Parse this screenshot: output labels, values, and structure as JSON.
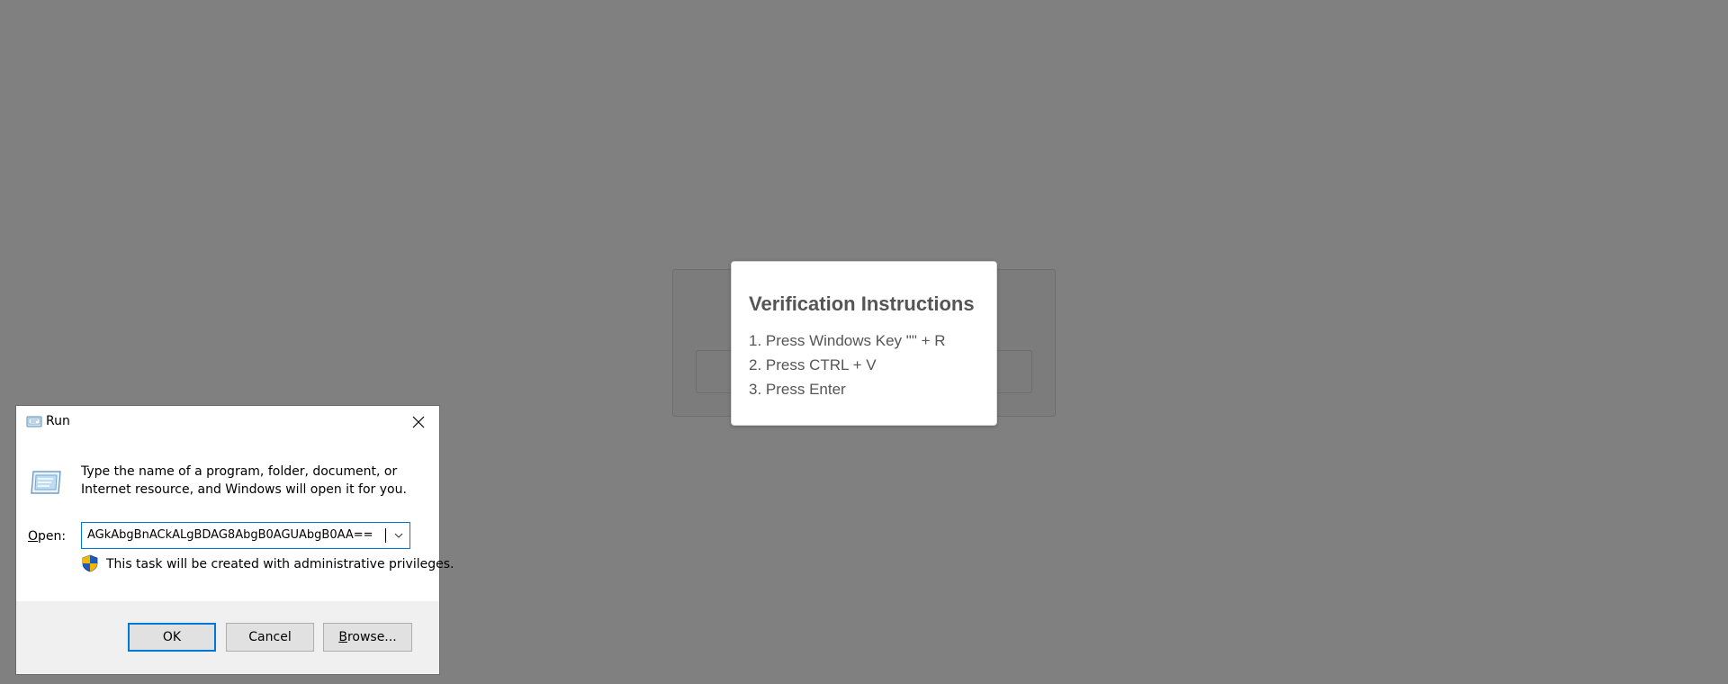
{
  "verification": {
    "title": "Verification Instructions",
    "steps": [
      "1. Press Windows Key \"\" + R",
      "2. Press CTRL + V",
      "3. Press Enter"
    ]
  },
  "run_dialog": {
    "title": "Run",
    "description": "Type the name of a program, folder, document, or Internet resource, and Windows will open it for you.",
    "open_label_underlined": "O",
    "open_label_rest": "pen:",
    "open_value": "AGkAbgBnACkALgBDAG8AbgB0AGUAbgB0AA==",
    "admin_note": "This task will be created with administrative privileges.",
    "buttons": {
      "ok": "OK",
      "cancel": "Cancel",
      "browse_underlined": "B",
      "browse_rest": "rowse..."
    }
  },
  "colors": {
    "backdrop": "#808080",
    "accent": "#0078d7"
  }
}
